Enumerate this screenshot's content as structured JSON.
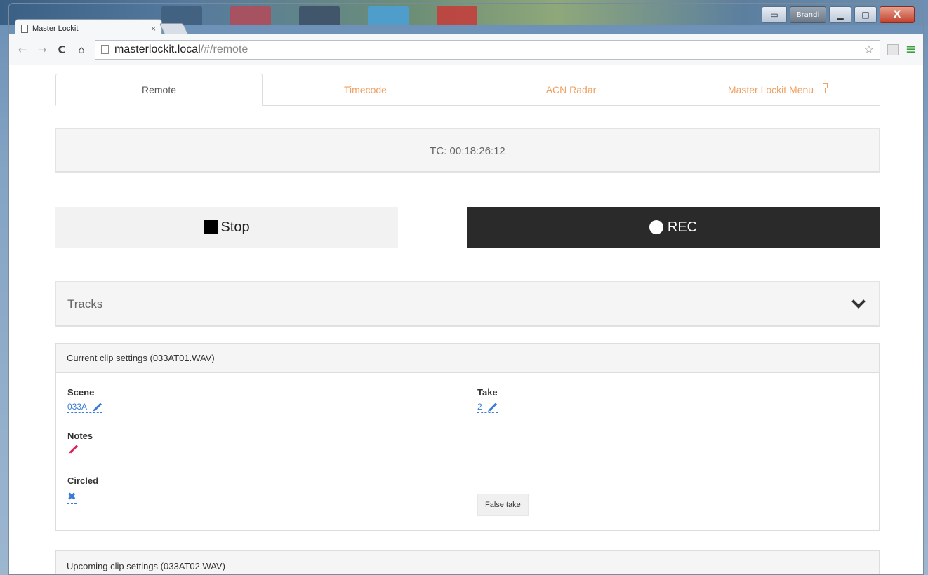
{
  "browser": {
    "tab_title": "Master Lockit",
    "tab_close": "×",
    "url_host": "masterlockit.local",
    "url_path": "/#/remote",
    "user_label": "Brandi",
    "close_label": "X",
    "back_glyph": "←",
    "forward_glyph": "→",
    "reload_glyph": "C",
    "home_glyph": "⌂",
    "star_glyph": "☆",
    "menu_glyph": "≡"
  },
  "nav": {
    "tabs": [
      {
        "label": "Remote",
        "active": true
      },
      {
        "label": "Timecode"
      },
      {
        "label": "ACN Radar"
      },
      {
        "label": "Master Lockit Menu"
      }
    ]
  },
  "timecode": {
    "text": "TC: 00:18:26:12"
  },
  "transport": {
    "stop_label": "Stop",
    "rec_label": "REC"
  },
  "tracks": {
    "label": "Tracks"
  },
  "current_clip": {
    "heading": "Current clip settings (033AT01.WAV)",
    "scene_label": "Scene",
    "scene_value": "033A",
    "take_label": "Take",
    "take_value": "2",
    "notes_label": "Notes",
    "circled_label": "Circled",
    "circled_glyph": "✖",
    "false_take_label": "False take"
  },
  "upcoming_clip": {
    "heading": "Upcoming clip settings (033AT02.WAV)"
  },
  "colors": {
    "accent": "#f0a060",
    "link": "#3a7bd5",
    "rec_bg": "#2a2a2a",
    "notes_pencil": "#d9245a"
  }
}
